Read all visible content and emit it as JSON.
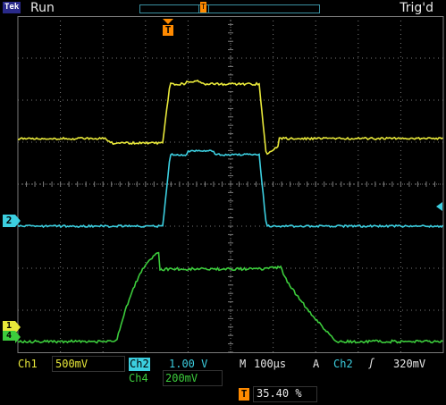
{
  "header": {
    "brand": "Tek",
    "run_state": "Run",
    "trigger_state": "Trig'd",
    "trigger_position_marker": "T"
  },
  "channels": {
    "ch1": {
      "label": "Ch1",
      "scale": "500mV",
      "color": "#e8e83a",
      "marker": "1"
    },
    "ch2": {
      "label": "Ch2",
      "scale": "1.00 V",
      "color": "#3ccfe0",
      "marker": "2"
    },
    "ch4": {
      "label": "Ch4",
      "scale": "200mV",
      "color": "#3ccc3c",
      "marker": "4"
    }
  },
  "timebase": {
    "label": "M",
    "scale": "100µs"
  },
  "trigger": {
    "mode_label": "A",
    "source": "Ch2",
    "slope_symbol": "ʃ",
    "level": "320mV"
  },
  "trigger_position": {
    "icon": "T",
    "value": "35.40 %"
  },
  "colors": {
    "background": "#000000",
    "grid": "#7a7a7a",
    "trigger": "#ff8a00"
  }
}
